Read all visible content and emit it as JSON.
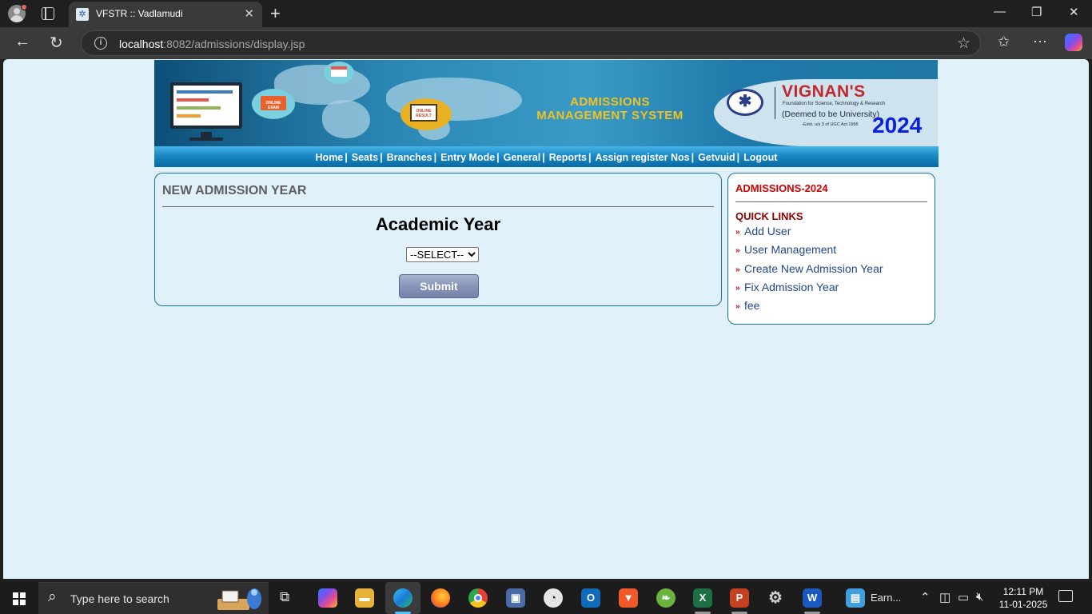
{
  "browser": {
    "tab_title": "VFSTR :: Vadlamudi",
    "url_host": "localhost",
    "url_rest": ":8082/admissions/display.jsp"
  },
  "banner": {
    "title_line1": "ADMISSIONS",
    "title_line2": "MANAGEMENT SYSTEM",
    "logo_name": "VIGNAN'S",
    "logo_sub": "Foundation for Science, Technology & Research",
    "logo_deemed": "(Deemed to be University)",
    "logo_estd": "-Estd. u/s 3 of UGC Act 1956",
    "year": "2024",
    "online_exam_label": "ONLINE EXAM",
    "online_result_label": "ONLINE RESULT"
  },
  "menu": [
    {
      "label": "Home"
    },
    {
      "label": "Seats"
    },
    {
      "label": "Branches"
    },
    {
      "label": "Entry Mode"
    },
    {
      "label": "General"
    },
    {
      "label": "Reports"
    },
    {
      "label": "Assign register Nos"
    },
    {
      "label": "Getvuid"
    },
    {
      "label": "Logout"
    }
  ],
  "main": {
    "heading": "NEW ADMISSION YEAR",
    "field_label": "Academic Year",
    "select_value": "--SELECT--",
    "submit_label": "Submit"
  },
  "sidebar": {
    "heading": "ADMISSIONS-2024",
    "quick_links_heading": "QUICK LINKS",
    "links": [
      {
        "label": "Add User"
      },
      {
        "label": "User Management"
      },
      {
        "label": "Create New Admission Year"
      },
      {
        "label": "Fix Admission Year"
      },
      {
        "label": "fee"
      }
    ]
  },
  "taskbar": {
    "search_placeholder": "Type here to search",
    "earn_label": "Earn...",
    "time": "12:11 PM",
    "date": "11-01-2025"
  },
  "colors": {
    "page_bg": "#e1f1fa",
    "panel_border": "#167399",
    "menu_bar": "#1a88c4",
    "sidebar_heading": "#d00000",
    "link": "#23468a",
    "banner_year": "#0a22e0"
  }
}
